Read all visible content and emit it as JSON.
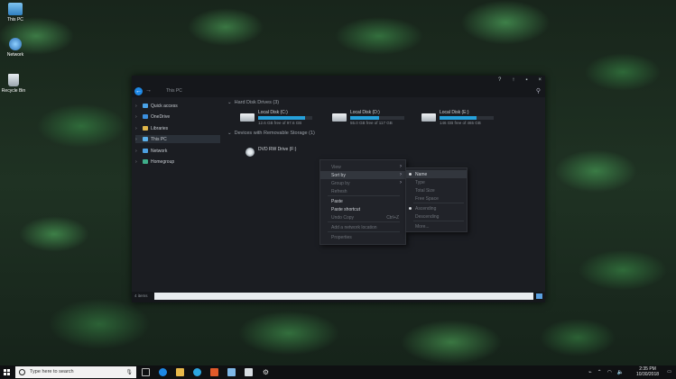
{
  "desktop": {
    "icons": [
      {
        "label": "This PC",
        "icon": "this-pc-icon"
      },
      {
        "label": "Network",
        "icon": "network-icon"
      },
      {
        "label": "Recycle Bin",
        "icon": "recycle-bin-icon"
      }
    ]
  },
  "window": {
    "address": "This PC",
    "title_controls": [
      "?",
      "↑",
      "▪",
      "×"
    ],
    "sidebar": [
      {
        "label": "Quick access",
        "icon": "star-icon",
        "color": "#4aa3e8"
      },
      {
        "label": "OneDrive",
        "icon": "cloud-icon",
        "color": "#3b8fde"
      },
      {
        "label": "Libraries",
        "icon": "library-icon",
        "color": "#e0b64a"
      },
      {
        "label": "This PC",
        "icon": "computer-icon",
        "color": "#5bb0ea",
        "selected": true
      },
      {
        "label": "Network",
        "icon": "network-icon",
        "color": "#4d9fe0"
      },
      {
        "label": "Homegroup",
        "icon": "homegroup-icon",
        "color": "#3fae8a"
      }
    ],
    "groups": {
      "hard_disks": "Hard Disk Drives (3)",
      "removable": "Devices with Removable Storage (1)"
    },
    "drives": [
      {
        "name": "Local Disk (C:)",
        "free": "12.6 GB free of 97.6 GB",
        "used_fraction": 0.87
      },
      {
        "name": "Local Disk (D:)",
        "free": "55.0 GB free of 117 GB",
        "used_fraction": 0.53
      },
      {
        "name": "Local Disk (E:)",
        "free": "146 GB free of 465 GB",
        "used_fraction": 0.69
      }
    ],
    "dvd": {
      "name": "DVD RW Drive (F:)"
    },
    "status": {
      "items": "4 items"
    }
  },
  "context_menu": {
    "items": [
      {
        "label": "View",
        "submenu": true,
        "dim": true
      },
      {
        "label": "Sort by",
        "submenu": true,
        "highlight": true
      },
      {
        "label": "Group by",
        "submenu": true,
        "dim": true
      },
      {
        "label": "Refresh",
        "dim": true
      },
      {
        "label": "Paste"
      },
      {
        "label": "Paste shortcut"
      },
      {
        "label": "Undo Copy",
        "shortcut": "Ctrl+Z",
        "dim": true
      },
      {
        "label": "Add a network location",
        "dim": true
      },
      {
        "label": "Properties",
        "dim": true
      }
    ]
  },
  "sort_submenu": {
    "items": [
      {
        "label": "Name",
        "checked": true
      },
      {
        "label": "Type",
        "dim": true
      },
      {
        "label": "Total Size",
        "dim": true
      },
      {
        "label": "Free Space",
        "dim": true
      },
      {
        "label": "Ascending",
        "checked": true,
        "dim": true
      },
      {
        "label": "Descending",
        "dim": true
      },
      {
        "label": "More...",
        "dim": true
      }
    ]
  },
  "taskbar": {
    "search_placeholder": "Type here to search",
    "time": "2:35 PM",
    "date": "10/30/2018"
  }
}
